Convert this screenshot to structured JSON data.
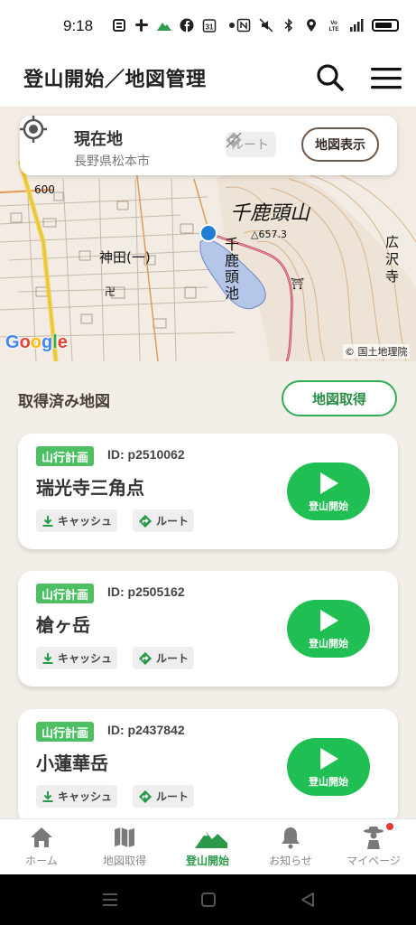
{
  "status_bar": {
    "time": "9:18"
  },
  "header": {
    "title": "登山開始／地図管理"
  },
  "map": {
    "location_title": "現在地",
    "location_sub": "長野県松本市",
    "route_label": "ルート",
    "map_display_label": "地図表示",
    "labels": {
      "mountain": "千鹿頭山",
      "elevation": "△657.3",
      "pond": "千鹿頭池",
      "kanda": "神田(一)",
      "kotakuji": "広沢寺",
      "road_number": "600"
    },
    "google": [
      "G",
      "o",
      "o",
      "g",
      "l",
      "e"
    ],
    "copyright": "© 国土地理院"
  },
  "section": {
    "title": "取得済み地図",
    "get_map_label": "地図取得"
  },
  "cards": [
    {
      "badge": "山行計画",
      "id": "ID: p2510062",
      "name": "瑞光寺三角点",
      "cache": "キャッシュ",
      "route": "ルート",
      "start": "登山開始"
    },
    {
      "badge": "山行計画",
      "id": "ID: p2505162",
      "name": "槍ヶ岳",
      "cache": "キャッシュ",
      "route": "ルート",
      "start": "登山開始"
    },
    {
      "badge": "山行計画",
      "id": "ID: p2437842",
      "name": "小蓮華岳",
      "cache": "キャッシュ",
      "route": "ルート",
      "start": "登山開始"
    }
  ],
  "nav": [
    {
      "label": "ホーム",
      "icon": "home-icon"
    },
    {
      "label": "地図取得",
      "icon": "map-icon"
    },
    {
      "label": "登山開始",
      "icon": "mountain-icon",
      "active": true
    },
    {
      "label": "お知らせ",
      "icon": "bell-icon"
    },
    {
      "label": "マイページ",
      "icon": "hiker-icon"
    }
  ],
  "colors": {
    "accent_green": "#1fbf53",
    "badge_green": "#4cbf63",
    "background": "#f3efe8"
  }
}
